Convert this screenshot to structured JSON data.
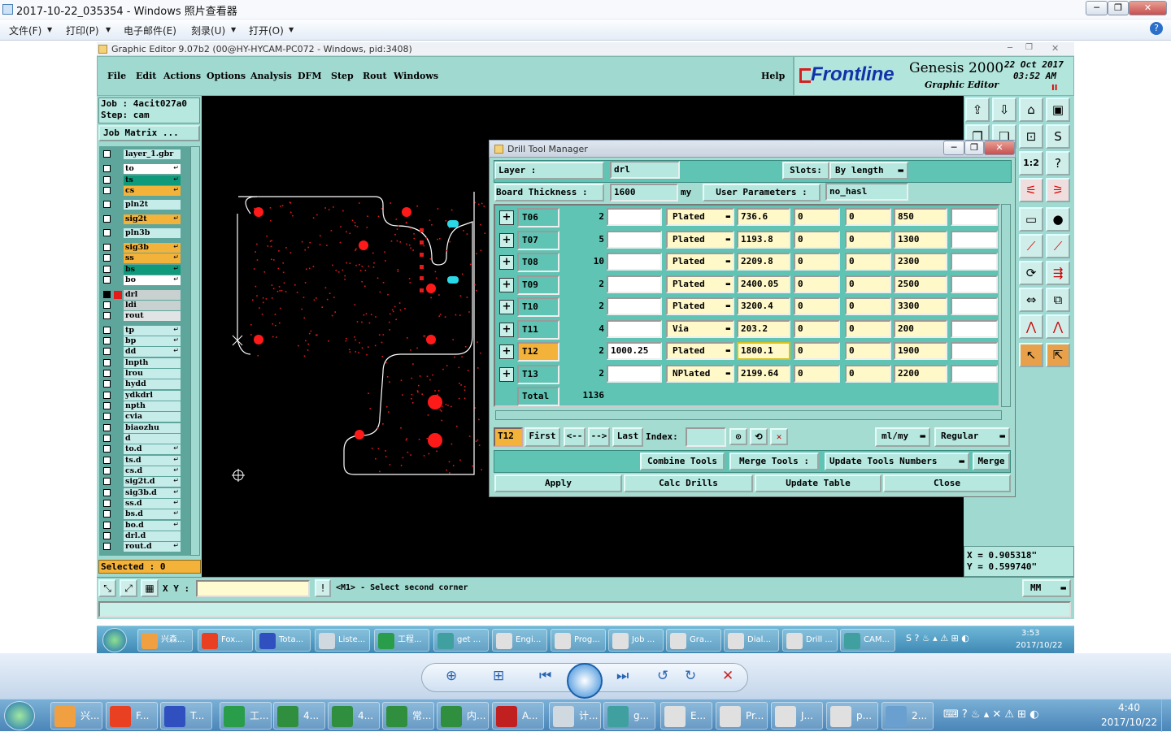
{
  "viewer": {
    "title": "2017-10-22_035354 - Windows 照片查看器",
    "menu": [
      "文件(F)",
      "打印(P)",
      "电子邮件(E)",
      "刻录(U)",
      "打开(O)"
    ]
  },
  "genesis": {
    "window_title": "Graphic Editor 9.07b2 (00@HY-HYCAM-PC072 - Windows, pid:3408)",
    "menu": [
      "File",
      "Edit",
      "Actions",
      "Options",
      "Analysis",
      "DFM",
      "Step",
      "Rout",
      "Windows"
    ],
    "help": "Help",
    "brand": "Frontline",
    "product": "Genesis 2000",
    "subtitle": "Graphic Editor",
    "date": "22 Oct 2017",
    "time": "03:52 AM",
    "job_line": "Job : 4acit027a0",
    "step_line": "Step: cam",
    "job_matrix": "Job Matrix ...",
    "selected": "Selected : 0",
    "coord_x": "X = 0.905318\"",
    "coord_y": "Y = 0.599740\"",
    "xy_label": "X Y :",
    "prompt": "<M1> - Select second corner",
    "units": "MM",
    "layers": [
      {
        "name": "layer_1.gbr",
        "color": "#c6ecea",
        "arrow": ""
      },
      {
        "name": "to",
        "color": "#ffffff",
        "arrow": "↵"
      },
      {
        "name": "ts",
        "color": "#0f9a7c",
        "arrow": "↵"
      },
      {
        "name": "cs",
        "color": "#f3b23a",
        "arrow": "↵"
      },
      {
        "name": "pln2t",
        "color": "#c6ecea",
        "arrow": ""
      },
      {
        "name": "sig2t",
        "color": "#f3b23a",
        "arrow": "↵"
      },
      {
        "name": "pln3b",
        "color": "#c6ecea",
        "arrow": ""
      },
      {
        "name": "sig3b",
        "color": "#f3b23a",
        "arrow": "↵"
      },
      {
        "name": "ss",
        "color": "#f3b23a",
        "arrow": "↵"
      },
      {
        "name": "bs",
        "color": "#0f9a7c",
        "arrow": "↵"
      },
      {
        "name": "bo",
        "color": "#ffffff",
        "arrow": "↵"
      },
      {
        "name": "drl",
        "color": "#c8d0d0",
        "arrow": ""
      },
      {
        "name": "ldi",
        "color": "#c8d0d0",
        "arrow": ""
      },
      {
        "name": "rout",
        "color": "#e0e4e4",
        "arrow": ""
      },
      {
        "name": "tp",
        "color": "#c6ecea",
        "arrow": "↵"
      },
      {
        "name": "bp",
        "color": "#c6ecea",
        "arrow": "↵"
      },
      {
        "name": "dd",
        "color": "#c6ecea",
        "arrow": "↵"
      },
      {
        "name": "lnpth",
        "color": "#c6ecea",
        "arrow": ""
      },
      {
        "name": "lrou",
        "color": "#c6ecea",
        "arrow": ""
      },
      {
        "name": "hydd",
        "color": "#c6ecea",
        "arrow": ""
      },
      {
        "name": "ydkdrl",
        "color": "#c6ecea",
        "arrow": ""
      },
      {
        "name": "npth",
        "color": "#c6ecea",
        "arrow": ""
      },
      {
        "name": "cvia",
        "color": "#c6ecea",
        "arrow": ""
      },
      {
        "name": "biaozhu",
        "color": "#c6ecea",
        "arrow": ""
      },
      {
        "name": "d",
        "color": "#c6ecea",
        "arrow": ""
      },
      {
        "name": "to.d",
        "color": "#c6ecea",
        "arrow": "↵"
      },
      {
        "name": "ts.d",
        "color": "#c6ecea",
        "arrow": "↵"
      },
      {
        "name": "cs.d",
        "color": "#c6ecea",
        "arrow": "↵"
      },
      {
        "name": "sig2t.d",
        "color": "#c6ecea",
        "arrow": "↵"
      },
      {
        "name": "sig3b.d",
        "color": "#c6ecea",
        "arrow": "↵"
      },
      {
        "name": "ss.d",
        "color": "#c6ecea",
        "arrow": "↵"
      },
      {
        "name": "bs.d",
        "color": "#c6ecea",
        "arrow": "↵"
      },
      {
        "name": "bo.d",
        "color": "#c6ecea",
        "arrow": "↵"
      },
      {
        "name": "drl.d",
        "color": "#c6ecea",
        "arrow": ""
      },
      {
        "name": "rout.d",
        "color": "#c6ecea",
        "arrow": "↵"
      }
    ]
  },
  "dialog": {
    "title": "Drill Tool Manager",
    "layer_label": "Layer :",
    "layer_value": "drl",
    "slots_label": "Slots:",
    "slots_value": "By length",
    "thickness_label": "Board Thickness :",
    "thickness_value": "1600",
    "thickness_unit": "my",
    "user_params_label": "User Parameters :",
    "user_params_value": "no_hasl",
    "rows": [
      {
        "tool": "T06",
        "count": "2",
        "c3": "",
        "type": "Plated",
        "size": "736.6",
        "c6": "0",
        "c7": "0",
        "finish": "850",
        "c9": ""
      },
      {
        "tool": "T07",
        "count": "5",
        "c3": "",
        "type": "Plated",
        "size": "1193.8",
        "c6": "0",
        "c7": "0",
        "finish": "1300",
        "c9": ""
      },
      {
        "tool": "T08",
        "count": "10",
        "c3": "",
        "type": "Plated",
        "size": "2209.8",
        "c6": "0",
        "c7": "0",
        "finish": "2300",
        "c9": ""
      },
      {
        "tool": "T09",
        "count": "2",
        "c3": "",
        "type": "Plated",
        "size": "2400.05",
        "c6": "0",
        "c7": "0",
        "finish": "2500",
        "c9": ""
      },
      {
        "tool": "T10",
        "count": "2",
        "c3": "",
        "type": "Plated",
        "size": "3200.4",
        "c6": "0",
        "c7": "0",
        "finish": "3300",
        "c9": ""
      },
      {
        "tool": "T11",
        "count": "4",
        "c3": "",
        "type": "Via",
        "size": "203.2",
        "c6": "0",
        "c7": "0",
        "finish": "200",
        "c9": ""
      },
      {
        "tool": "T12",
        "count": "2",
        "c3": "1000.25",
        "type": "Plated",
        "size": "1800.1",
        "c6": "0",
        "c7": "0",
        "finish": "1900",
        "c9": ""
      },
      {
        "tool": "T13",
        "count": "2",
        "c3": "",
        "type": "NPlated",
        "size": "2199.64",
        "c6": "0",
        "c7": "0",
        "finish": "2200",
        "c9": ""
      }
    ],
    "total_label": "Total",
    "total_value": "1136",
    "current_tool": "T12",
    "nav": [
      "First",
      "<--",
      "-->",
      "Last"
    ],
    "index_label": "Index:",
    "unit_select": "ml/my",
    "mode_select": "Regular",
    "combine": "Combine Tools",
    "merge_tools": "Merge Tools :",
    "update_numbers": "Update Tools Numbers",
    "merge": "Merge",
    "actions": [
      "Apply",
      "Calc Drills",
      "Update Table",
      "Close"
    ]
  },
  "taskbar_inner": {
    "items": [
      "兴森...",
      "Fox...",
      "Tota...",
      "Liste...",
      "工程...",
      "get ...",
      "Engi...",
      "Prog...",
      "Job ...",
      "Gra...",
      "Dial...",
      "Drill ...",
      "CAM..."
    ],
    "time": "3:53",
    "date": "2017/10/22"
  },
  "taskbar_outer": {
    "items": [
      "兴...",
      "F...",
      "T...",
      "工...",
      "4...",
      "4...",
      "常...",
      "内...",
      "A...",
      "计...",
      "g...",
      "E...",
      "Pr...",
      "J...",
      "p...",
      "2..."
    ],
    "time": "4:40",
    "date": "2017/10/22"
  }
}
